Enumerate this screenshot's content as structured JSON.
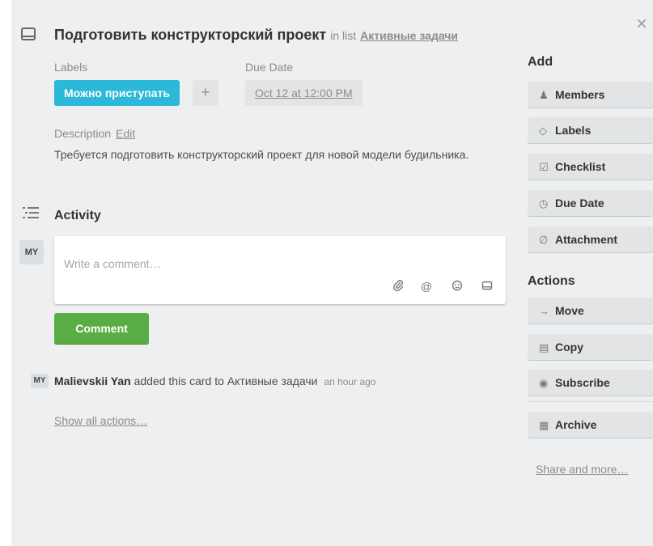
{
  "card": {
    "title": "Подготовить конструкторский проект",
    "in_list_prefix": "in list",
    "list_name": "Активные задачи",
    "close_glyph": "×"
  },
  "labels": {
    "heading": "Labels",
    "chip": "Можно приступать",
    "chip_color": "#2bb8d9",
    "add_glyph": "+"
  },
  "due": {
    "heading": "Due Date",
    "value": "Oct 12 at 12:00 PM"
  },
  "description": {
    "heading": "Description",
    "edit": "Edit",
    "text": "Требуется подготовить конструкторский проект для новой модели будильника."
  },
  "activity": {
    "heading": "Activity",
    "avatar_initials": "MY",
    "comment_placeholder": "Write a comment…",
    "comment_button": "Comment",
    "comment_button_color": "#5aac44",
    "entry": {
      "avatar": "MY",
      "user": "Malievskii Yan",
      "action": "added this card to Активные задачи",
      "time": "an hour ago"
    },
    "show_all": "Show all actions…"
  },
  "sidebar": {
    "add_heading": "Add",
    "add_items": [
      {
        "label": "Members",
        "icon": "person-icon"
      },
      {
        "label": "Labels",
        "icon": "tag-icon"
      },
      {
        "label": "Checklist",
        "icon": "checkbox-icon"
      },
      {
        "label": "Due Date",
        "icon": "clock-icon"
      },
      {
        "label": "Attachment",
        "icon": "paperclip-icon"
      }
    ],
    "actions_heading": "Actions",
    "action_items": [
      {
        "label": "Move",
        "icon": "arrow-right-icon"
      },
      {
        "label": "Copy",
        "icon": "card-icon"
      },
      {
        "label": "Subscribe",
        "icon": "eye-icon"
      },
      {
        "label": "Archive",
        "icon": "archive-icon"
      }
    ],
    "share": "Share and more…"
  }
}
